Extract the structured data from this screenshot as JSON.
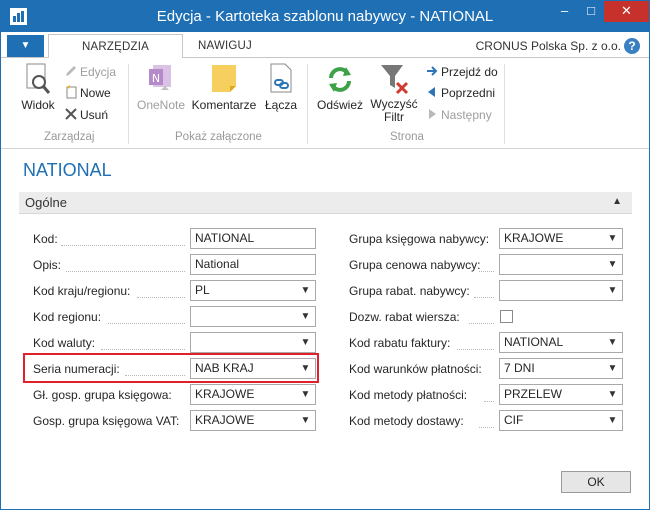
{
  "window": {
    "title": "Edycja - Kartoteka szablonu nabywcy - NATIONAL",
    "minimize_glyph": "–",
    "maximize_glyph": "□",
    "close_glyph": "✕"
  },
  "ribbon_tabs": {
    "app_menu_glyph": "▼",
    "home": "NARZĘDZIA GŁÓWNE",
    "navigate": "NAWIGUJ"
  },
  "company": "CRONUS Polska Sp. z o.o.",
  "help_glyph": "?",
  "ribbon": {
    "manage": {
      "label": "Zarządzaj",
      "view": "Widok",
      "edit": "Edycja",
      "new": "Nowe",
      "delete": "Usuń"
    },
    "attachments": {
      "label": "Pokaż załączone",
      "onenote": "OneNote",
      "comments": "Komentarze",
      "links": "Łącza"
    },
    "page": {
      "label": "Strona",
      "refresh": "Odśwież",
      "clear_filter_line1": "Wyczyść",
      "clear_filter_line2": "Filtr",
      "goto": "Przejdź do",
      "previous": "Poprzedni",
      "next": "Następny"
    }
  },
  "page_title": "NATIONAL",
  "fasttab": {
    "title": "Ogólne"
  },
  "left_fields": [
    {
      "label": "Kod:",
      "value": "NATIONAL",
      "dropdown": false
    },
    {
      "label": "Opis:",
      "value": "National",
      "dropdown": false
    },
    {
      "label": "Kod kraju/regionu:",
      "value": "PL",
      "dropdown": true
    },
    {
      "label": "Kod regionu:",
      "value": "",
      "dropdown": true
    },
    {
      "label": "Kod waluty:",
      "value": "",
      "dropdown": true
    },
    {
      "label": "Seria numeracji:",
      "value": "NAB KRAJ",
      "dropdown": true
    },
    {
      "label": "Gł. gosp. grupa księgowa:",
      "value": "KRAJOWE",
      "dropdown": true
    },
    {
      "label": "Gosp. grupa księgowa VAT:",
      "value": "KRAJOWE",
      "dropdown": true
    }
  ],
  "right_fields": [
    {
      "label": "Grupa księgowa nabywcy:",
      "value": "KRAJOWE",
      "type": "dropdown"
    },
    {
      "label": "Grupa cenowa nabywcy:",
      "value": "",
      "type": "dropdown"
    },
    {
      "label": "Grupa rabat. nabywcy:",
      "value": "",
      "type": "dropdown"
    },
    {
      "label": "Dozw. rabat wiersza:",
      "value": "",
      "type": "checkbox",
      "checked": false
    },
    {
      "label": "Kod rabatu faktury:",
      "value": "NATIONAL",
      "type": "dropdown"
    },
    {
      "label": "Kod warunków płatności:",
      "value": "7 DNI",
      "type": "dropdown"
    },
    {
      "label": "Kod metody płatności:",
      "value": "PRZELEW",
      "type": "dropdown"
    },
    {
      "label": "Kod metody dostawy:",
      "value": "CIF",
      "type": "dropdown"
    }
  ],
  "ok_button": "OK",
  "colors": {
    "accent": "#1f6fb4",
    "highlight": "#e0202a"
  }
}
